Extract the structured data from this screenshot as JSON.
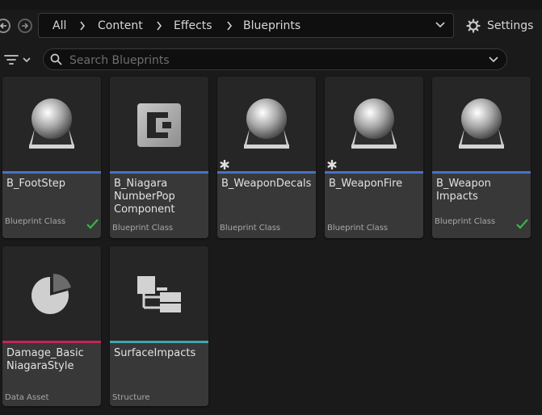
{
  "toolbar": {
    "breadcrumb": [
      "All",
      "Content",
      "Effects",
      "Blueprints"
    ],
    "settings_label": "Settings"
  },
  "search": {
    "placeholder": "Search Blueprints",
    "value": ""
  },
  "colors": {
    "blueprint": "#4a70c8",
    "data_asset": "#c2245a",
    "structure": "#3fa6b2",
    "check": "#3bb54a"
  },
  "assets": [
    {
      "name": "B_FootStep",
      "type": "Blueprint Class",
      "icon": "sphere-icon",
      "bar": "blueprint",
      "checked": true,
      "modified": false
    },
    {
      "name": "B_Niagara NumberPop Component",
      "type": "Blueprint Class",
      "icon": "component-icon",
      "bar": "blueprint",
      "checked": false,
      "modified": false
    },
    {
      "name": "B_WeaponDecals",
      "type": "Blueprint Class",
      "icon": "sphere-icon",
      "bar": "blueprint",
      "checked": false,
      "modified": true
    },
    {
      "name": "B_WeaponFire",
      "type": "Blueprint Class",
      "icon": "sphere-icon",
      "bar": "blueprint",
      "checked": false,
      "modified": true
    },
    {
      "name": "B_Weapon Impacts",
      "type": "Blueprint Class",
      "icon": "sphere-icon",
      "bar": "blueprint",
      "checked": true,
      "modified": false
    },
    {
      "name": "Damage_Basic NiagaraStyle",
      "type": "Data Asset",
      "icon": "pie-icon",
      "bar": "data_asset",
      "checked": false,
      "modified": false
    },
    {
      "name": "SurfaceImpacts",
      "type": "Structure",
      "icon": "structure-icon",
      "bar": "structure",
      "checked": false,
      "modified": false
    }
  ]
}
